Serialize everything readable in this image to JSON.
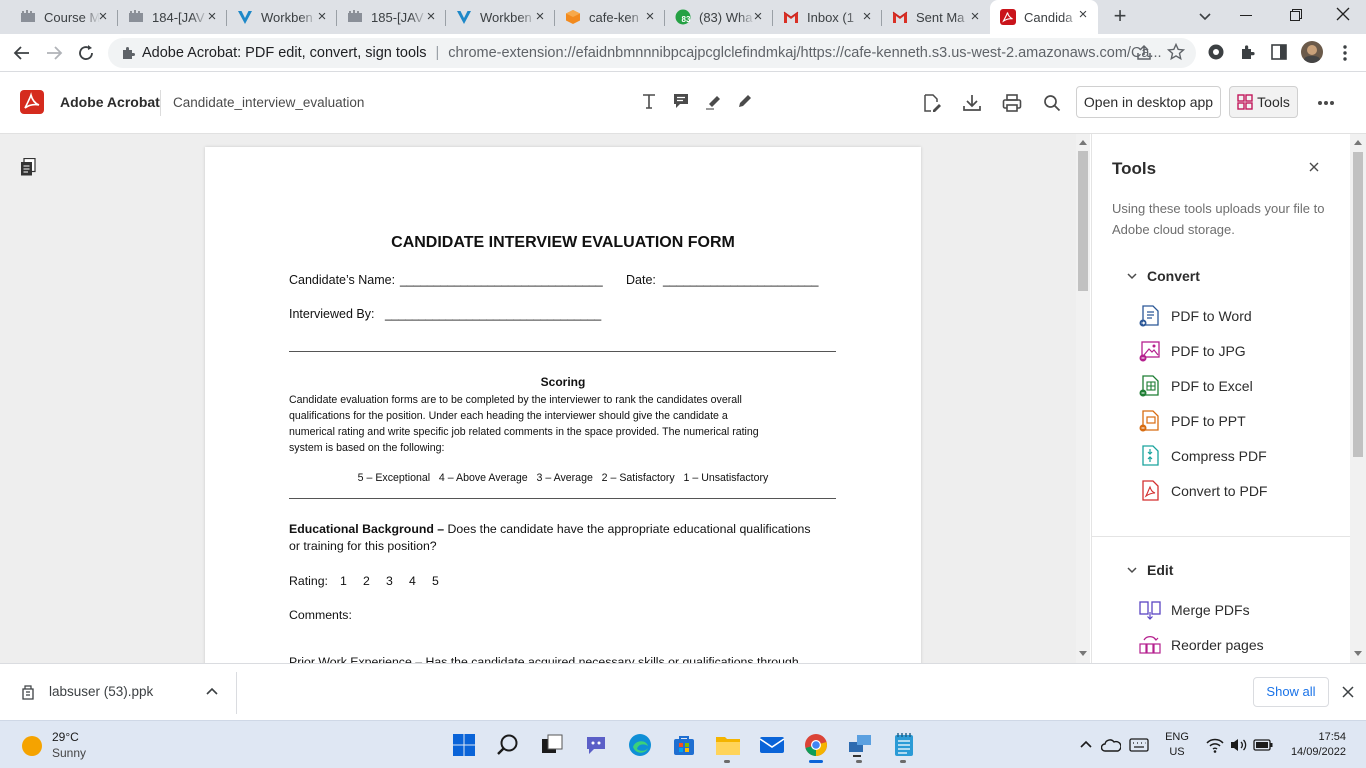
{
  "browser": {
    "tabs": [
      {
        "title": "Course M",
        "icon": "course-icon"
      },
      {
        "title": "184-[JAV",
        "icon": "course-icon"
      },
      {
        "title": "Workben",
        "icon": "vocareum-icon"
      },
      {
        "title": "185-[JAV",
        "icon": "course-icon"
      },
      {
        "title": "Workben",
        "icon": "vocareum-icon"
      },
      {
        "title": "cafe-ken",
        "icon": "aws-icon"
      },
      {
        "title": "(83) Wha",
        "icon": "whatsapp-icon",
        "badge": "83"
      },
      {
        "title": "Inbox (1",
        "icon": "gmail-icon"
      },
      {
        "title": "Sent Ma",
        "icon": "gmail-icon"
      },
      {
        "title": "Candida",
        "icon": "acrobat-icon",
        "active": true
      }
    ],
    "address": {
      "site_name": "Adobe Acrobat: PDF edit, convert, sign tools",
      "url": "chrome-extension://efaidnbmnnnibpcajpcglclefindmkaj/https://cafe-kenneth.s3.us-west-2.amazonaws.com/Ca..."
    }
  },
  "acrobat": {
    "brand": "Adobe Acrobat",
    "filename": "Candidate_interview_evaluation",
    "open_desktop_label": "Open in desktop app",
    "tools_label": "Tools"
  },
  "document": {
    "title": "CANDIDATE INTERVIEW EVALUATION FORM",
    "name_label": "Candidate’s Name:",
    "name_blank": "______________________________",
    "date_label": "Date:",
    "date_blank": "_______________________",
    "interviewed_label": "Interviewed By:",
    "interviewed_blank": "________________________________",
    "scoring_heading": "Scoring",
    "scoring_lines": [
      "Candidate evaluation forms are to be completed by the interviewer to rank the candidates overall",
      "qualifications for the position.  Under each heading the interviewer should give the candidate a",
      "numerical rating and write specific job related comments in the space provided.  The numerical rating",
      "system is based on the following:"
    ],
    "rating_scale": "5 – Exceptional   4 – Above Average   3 – Average   2 – Satisfactory   1 – Unsatisfactory",
    "edu_heading": "Educational Background –",
    "edu_text_1": " Does the candidate have the appropriate educational qualifications",
    "edu_text_2": "or training for this position?",
    "rating_label": "Rating:",
    "rating_values": [
      "1",
      "2",
      "3",
      "4",
      "5"
    ],
    "comments_label": "Comments:",
    "next_section_partial": "Prior Work Experience – Has the candidate acquired necessary skills or qualifications through"
  },
  "tools_panel": {
    "title": "Tools",
    "description": "Using these tools uploads your file to Adobe cloud storage.",
    "convert_heading": "Convert",
    "convert_items": [
      "PDF to Word",
      "PDF to JPG",
      "PDF to Excel",
      "PDF to PPT",
      "Compress PDF",
      "Convert to PDF"
    ],
    "edit_heading": "Edit",
    "edit_items": [
      "Merge PDFs",
      "Reorder pages"
    ],
    "colors": {
      "word": "#2b5797",
      "jpg": "#b5208e",
      "excel": "#1e7e34",
      "ppt": "#d86c10",
      "compress": "#1aa39e",
      "convert": "#d32f2f",
      "merge": "#5b45c4"
    }
  },
  "download": {
    "filename": "labsuser (53).ppk",
    "show_all_label": "Show all"
  },
  "taskbar": {
    "temperature": "29°C",
    "weather": "Sunny",
    "lang": "ENG",
    "region": "US",
    "time": "17:54",
    "date": "14/09/2022"
  }
}
